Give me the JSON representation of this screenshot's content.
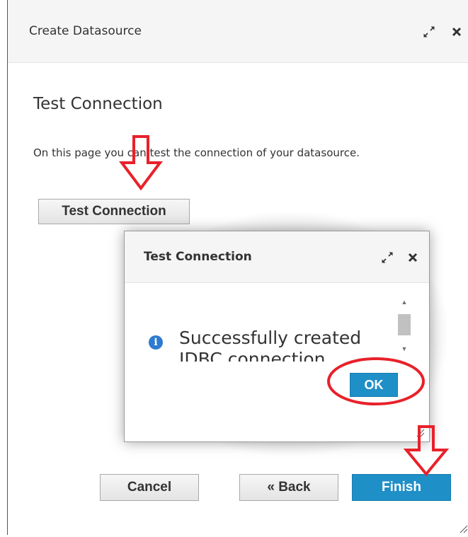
{
  "outer_dialog": {
    "title": "Create Datasource",
    "maximize_icon": "expand-arrows-icon",
    "close_icon": "close-x-icon"
  },
  "page": {
    "heading": "Test Connection",
    "description": "On this page you can test the connection of your datasource.",
    "test_button_label": "Test Connection"
  },
  "modal": {
    "title": "Test Connection",
    "info_icon": "info-circle-icon",
    "message": "Successfully created JDBC connection",
    "ok_label": "OK"
  },
  "footer": {
    "cancel_label": "Cancel",
    "back_label": "« Back",
    "finish_label": "Finish"
  },
  "colors": {
    "primary_button": "#1f8fc7",
    "annotation_red": "#e8212a",
    "info_icon": "#2f7ad0",
    "header_bg": "#f5f5f5"
  }
}
